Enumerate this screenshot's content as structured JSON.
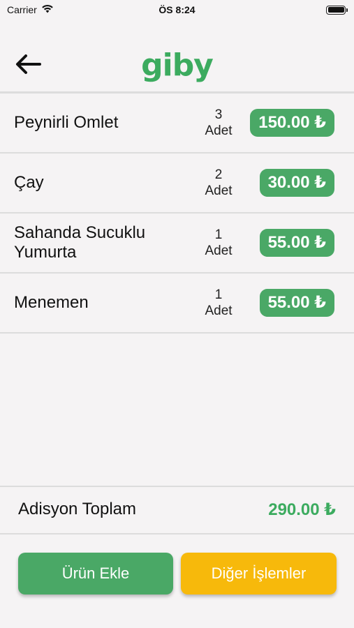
{
  "status_bar": {
    "carrier": "Carrier",
    "time": "ÖS 8:24"
  },
  "header": {
    "logo_text": "giby",
    "back_icon": "arrow-left-icon"
  },
  "order_items": [
    {
      "name": "Peynirli Omlet",
      "qty": "3",
      "unit": "Adet",
      "price": "150.00 ₺"
    },
    {
      "name": "Çay",
      "qty": "2",
      "unit": "Adet",
      "price": "30.00 ₺"
    },
    {
      "name": "Sahanda Sucuklu Yumurta",
      "qty": "1",
      "unit": "Adet",
      "price": "55.00 ₺"
    },
    {
      "name": "Menemen",
      "qty": "1",
      "unit": "Adet",
      "price": "55.00 ₺"
    }
  ],
  "total": {
    "label": "Adisyon Toplam",
    "value": "290.00 ₺"
  },
  "actions": {
    "add_label": "Ürün Ekle",
    "other_label": "Diğer İşlemler"
  },
  "colors": {
    "brand_green": "#3cab5f",
    "badge_green": "#4aa866",
    "action_yellow": "#f7b90b"
  }
}
